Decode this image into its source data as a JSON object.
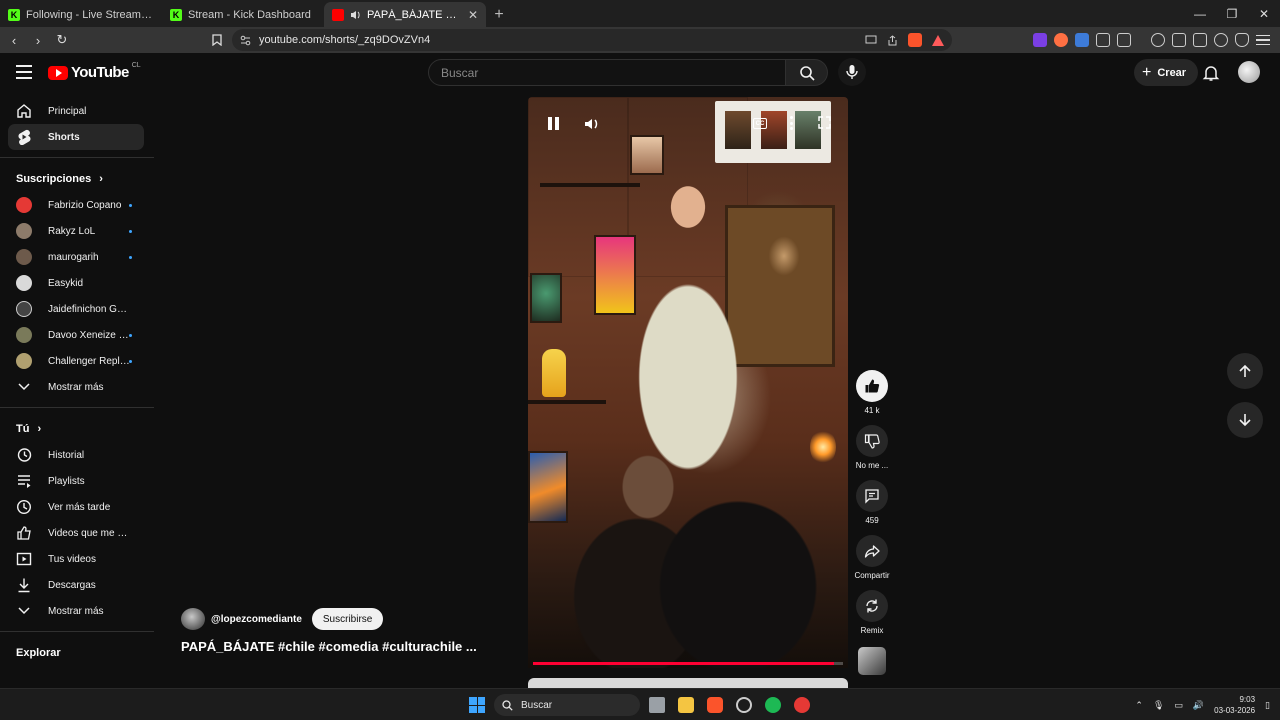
{
  "browser": {
    "tabs": [
      {
        "title": "Following - Live Streams on Kick",
        "active": false
      },
      {
        "title": "Stream - Kick Dashboard",
        "active": false
      },
      {
        "title": "PAPÁ_BÁJATE #chile #comedia",
        "active": true
      }
    ],
    "url": "youtube.com/shorts/_zq9DOvZVn4"
  },
  "youtube": {
    "logo_text": "YouTube",
    "country_code": "CL",
    "search_placeholder": "Buscar",
    "create_label": "Crear"
  },
  "sidebar": {
    "main": [
      {
        "label": "Principal",
        "icon": "home-icon"
      },
      {
        "label": "Shorts",
        "icon": "shorts-icon",
        "active": true
      }
    ],
    "subscriptions_header": "Suscripciones",
    "subscriptions": [
      {
        "label": "Fabrizio Copano",
        "color": "#e53935",
        "live": true
      },
      {
        "label": "Rakyz LoL",
        "color": "#8d7b6a",
        "live": true
      },
      {
        "label": "maurogarih",
        "color": "#6d5a4b",
        "live": true
      },
      {
        "label": "Easykid",
        "color": "#d9d9d9",
        "live": false
      },
      {
        "label": "Jaidefinichon GOTH",
        "color": "#444444",
        "live": false
      },
      {
        "label": "Davoo Xeneize P...",
        "color": "#7a7a5a",
        "live": true
      },
      {
        "label": "Challenger Repla...",
        "color": "#b0a070",
        "live": true
      }
    ],
    "show_more_1": "Mostrar más",
    "you_header": "Tú",
    "you": [
      {
        "label": "Historial",
        "icon": "history-icon"
      },
      {
        "label": "Playlists",
        "icon": "playlists-icon"
      },
      {
        "label": "Ver más tarde",
        "icon": "watch-later-icon"
      },
      {
        "label": "Videos que me gus...",
        "icon": "liked-icon"
      },
      {
        "label": "Tus videos",
        "icon": "your-videos-icon"
      },
      {
        "label": "Descargas",
        "icon": "downloads-icon"
      }
    ],
    "show_more_2": "Mostrar más",
    "explore_header": "Explorar"
  },
  "short": {
    "channel": "@lopezcomediante",
    "subscribe_label": "Suscribirse",
    "title": "PAPÁ_BÁJATE #chile #comedia #culturachile ...",
    "cc_label": "CC",
    "progress": 0.97
  },
  "actions": {
    "likes": "41 k",
    "dislike_label": "No me ...",
    "comments": "459",
    "share_label": "Compartir",
    "remix_label": "Remix"
  },
  "taskbar": {
    "search_label": "Buscar",
    "time": "9:03",
    "date": "03-03-2026"
  },
  "colors": {
    "accent_red": "#ff0000",
    "progress_red": "#ff0033",
    "live_blue": "#3ea6ff"
  }
}
